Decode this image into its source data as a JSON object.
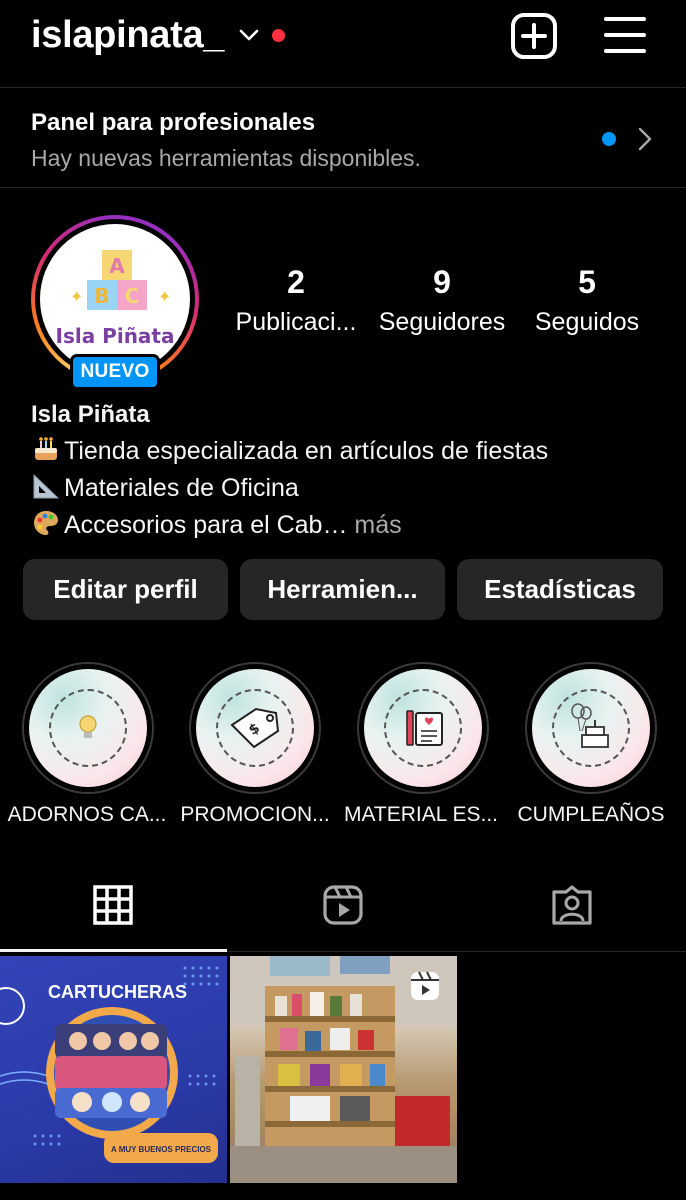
{
  "header": {
    "username": "islapinata_",
    "icons": [
      "chevron-down-icon",
      "notification-dot",
      "new-post-icon",
      "menu-icon"
    ]
  },
  "panel": {
    "title": "Panel para profesionales",
    "subtitle": "Hay nuevas herramientas disponibles."
  },
  "profile": {
    "avatar_text": "Isla Piñata",
    "avatar_blocks": [
      "A",
      "B",
      "C"
    ],
    "badge": "NUEVO",
    "stats": [
      {
        "count": "2",
        "label": "Publicaci..."
      },
      {
        "count": "9",
        "label": "Seguidores"
      },
      {
        "count": "5",
        "label": "Seguidos"
      }
    ],
    "name": "Isla Piñata",
    "bio": [
      {
        "icon": "cake-emoji",
        "text": "Tienda especializada en artículos de fiestas"
      },
      {
        "icon": "triangular-ruler-emoji",
        "text": "Materiales de Oficina"
      },
      {
        "icon": "palette-emoji",
        "text": "Accesorios para el Cab…"
      }
    ],
    "more": "más"
  },
  "buttons": [
    "Editar perfil",
    "Herramien...",
    "Estadísticas"
  ],
  "highlights": [
    {
      "label": "ADORNOS CA...",
      "icon": "lightbulb-icon"
    },
    {
      "label": "PROMOCION...",
      "icon": "price-tag-icon"
    },
    {
      "label": "MATERIAL ES...",
      "icon": "school-supplies-icon"
    },
    {
      "label": "CUMPLEAÑOS",
      "icon": "birthday-cake-icon"
    }
  ],
  "tabs": [
    "grid-icon",
    "reels-icon",
    "tagged-icon"
  ],
  "posts": [
    {
      "title": "CARTUCHERAS",
      "tag": "A MUY BUENOS PRECIOS"
    },
    {
      "type": "reel"
    }
  ],
  "colors": {
    "background": "#000000",
    "secondary_text": "#a8a8a8",
    "button_bg": "#262626",
    "accent_blue": "#0095f6",
    "notification_red": "#ff3040"
  }
}
